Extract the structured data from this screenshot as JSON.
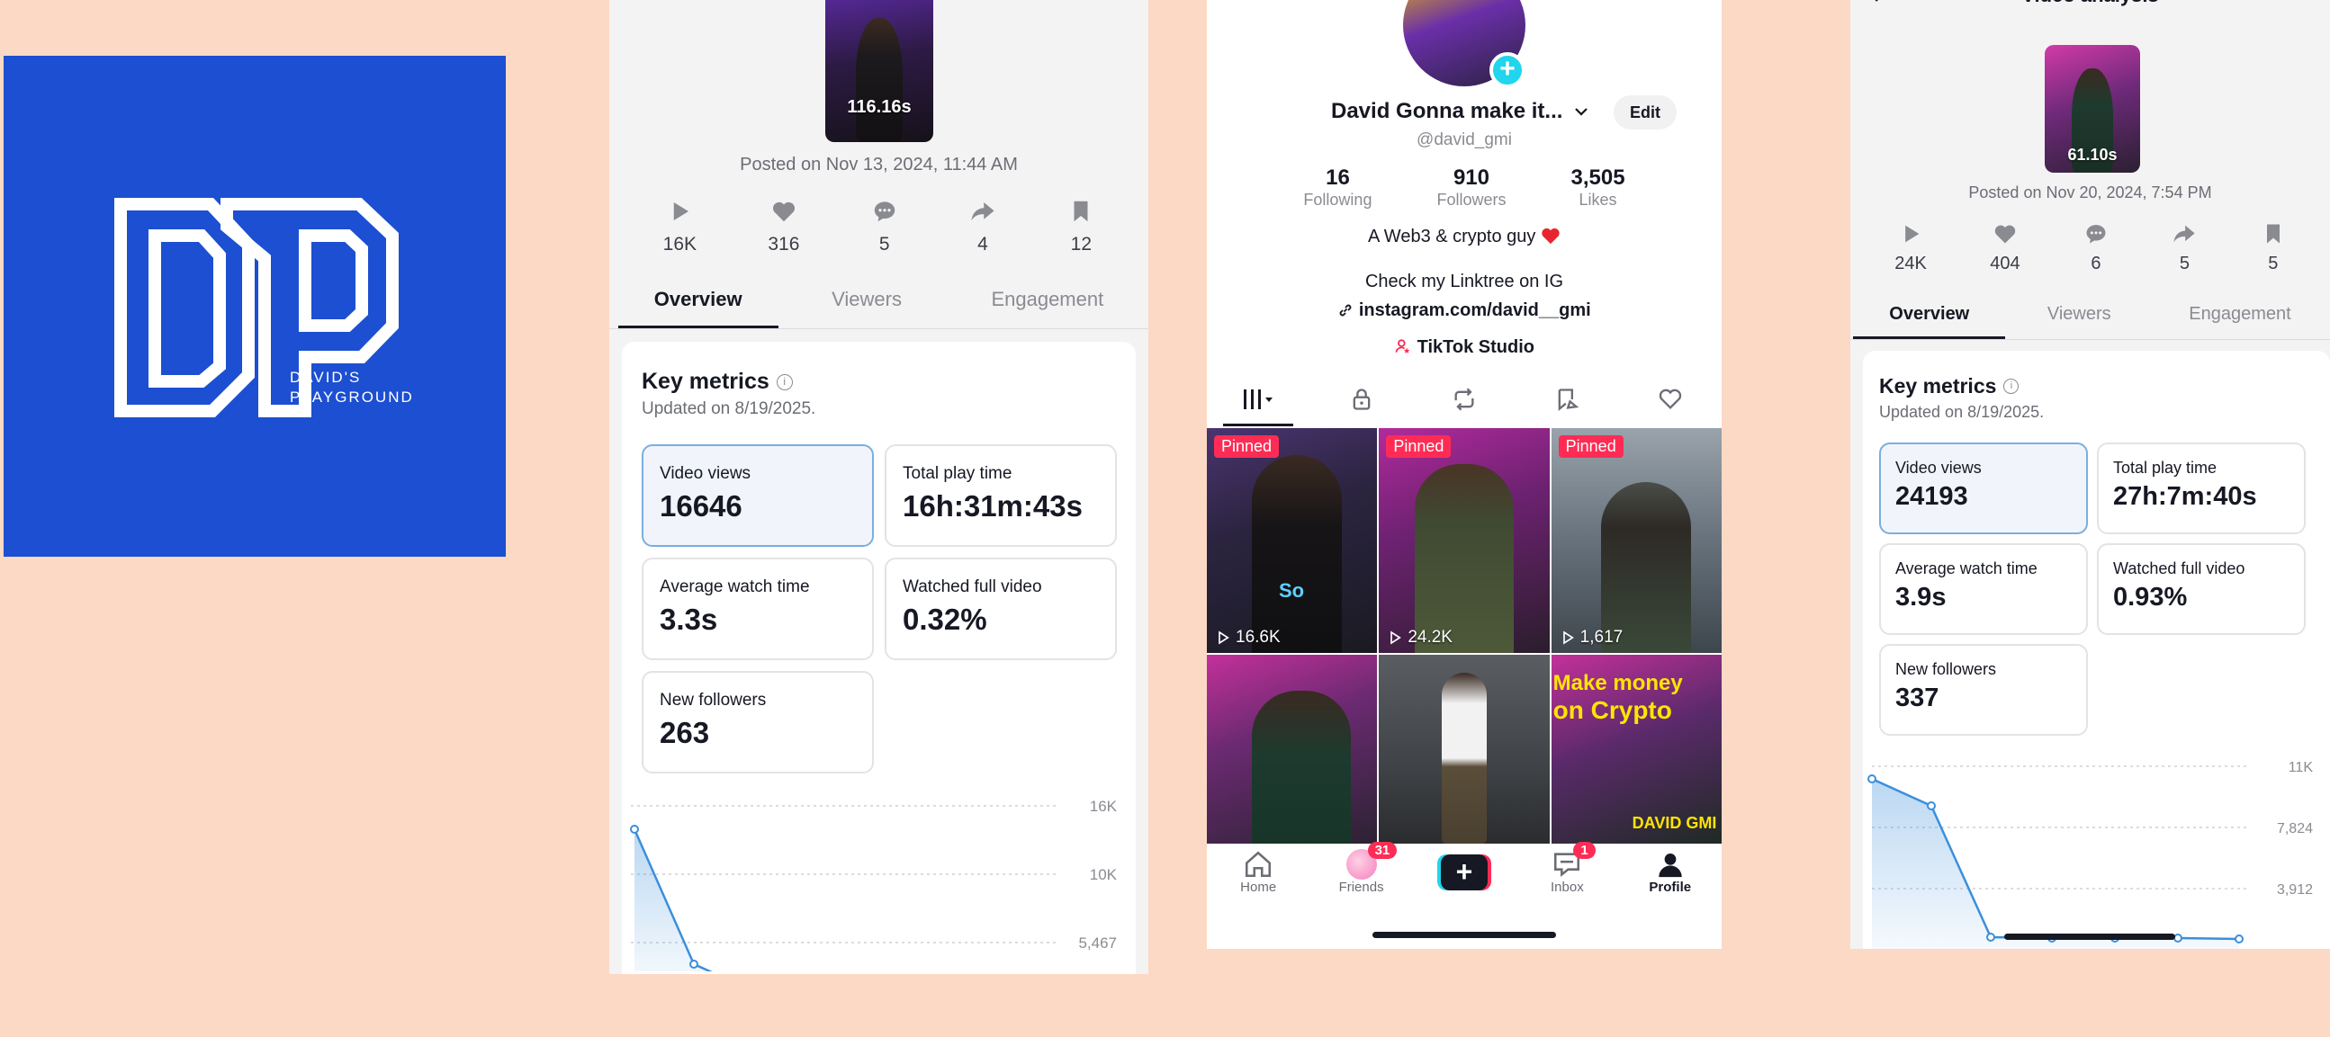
{
  "logo": {
    "line1": "DAVID'S",
    "line2": "PLAYGROUND",
    "bg": "#1c4fd1"
  },
  "analytics_left": {
    "thumb_duration": "116.16s",
    "posted": "Posted on Nov 13, 2024, 11:44 AM",
    "stats": {
      "views": "16K",
      "likes": "316",
      "comments": "5",
      "shares": "4",
      "saves": "12"
    },
    "tabs": [
      "Overview",
      "Viewers",
      "Engagement"
    ],
    "key_metrics_title": "Key metrics",
    "updated": "Updated on 8/19/2025.",
    "metrics": [
      {
        "label": "Video views",
        "value": "16646"
      },
      {
        "label": "Total play time",
        "value": "16h:31m:43s"
      },
      {
        "label": "Average watch time",
        "value": "3.3s"
      },
      {
        "label": "Watched full video",
        "value": "0.32%"
      },
      {
        "label": "New followers",
        "value": "263"
      }
    ],
    "chart_ticks": [
      "16K",
      "10K",
      "5,467"
    ]
  },
  "profile": {
    "name": "David Gonna make it...",
    "edit_label": "Edit",
    "handle": "@david_gmi",
    "following": "16",
    "following_label": "Following",
    "followers": "910",
    "followers_label": "Followers",
    "likes": "3,505",
    "likes_label": "Likes",
    "bio1": "A Web3 & crypto guy",
    "bio2": "Check my Linktree on IG",
    "link": "instagram.com/david__gmi",
    "studio": "TikTok Studio",
    "pinned_label": "Pinned",
    "videos": [
      {
        "views": "16.6K",
        "pinned": true
      },
      {
        "views": "24.2K",
        "pinned": true
      },
      {
        "views": "1,617",
        "pinned": true
      },
      {
        "views": "",
        "pinned": false
      },
      {
        "views": "",
        "pinned": false
      },
      {
        "views": "",
        "pinned": false,
        "overlay1": "Make money",
        "overlay2": "on Crypto",
        "overlay3": "DAVID GMI"
      }
    ],
    "thumb_overlay_so": "So",
    "nav": {
      "home": "Home",
      "friends": "Friends",
      "friends_badge": "31",
      "inbox": "Inbox",
      "inbox_badge": "1",
      "profile": "Profile"
    }
  },
  "analytics_right": {
    "title": "Video analysis",
    "thumb_duration": "61.10s",
    "posted": "Posted on Nov 20, 2024, 7:54 PM",
    "stats": {
      "views": "24K",
      "likes": "404",
      "comments": "6",
      "shares": "5",
      "saves": "5"
    },
    "tabs": [
      "Overview",
      "Viewers",
      "Engagement"
    ],
    "key_metrics_title": "Key metrics",
    "updated": "Updated on 8/19/2025.",
    "metrics": [
      {
        "label": "Video views",
        "value": "24193"
      },
      {
        "label": "Total play time",
        "value": "27h:7m:40s"
      },
      {
        "label": "Average watch time",
        "value": "3.9s"
      },
      {
        "label": "Watched full video",
        "value": "0.93%"
      },
      {
        "label": "New followers",
        "value": "337"
      }
    ],
    "chart_ticks": [
      "11K",
      "7,824",
      "3,912"
    ]
  },
  "colors": {
    "background": "#fcd9c5",
    "tiktok_red": "#fe2c55",
    "tiktok_cyan": "#20d5ec",
    "chart_blue": "#3b8fdb"
  }
}
